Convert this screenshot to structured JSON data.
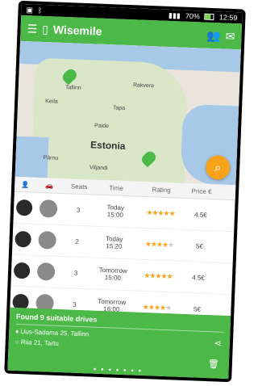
{
  "statusbar": {
    "time": "12:59",
    "battery": "70%"
  },
  "appbar": {
    "title": "Wisemile"
  },
  "map": {
    "labels": [
      "Tallinn",
      "Rakvere",
      "Keila",
      "Tapa",
      "Paide",
      "Pärnu",
      "Viljandi"
    ],
    "country": "Estonia"
  },
  "table": {
    "headers": {
      "seats": "Seats",
      "time": "Time",
      "rating": "Rating",
      "price": "Price €"
    },
    "rows": [
      {
        "seats": "3",
        "day": "Today",
        "time": "15:00",
        "stars": 5,
        "price": "4.5€"
      },
      {
        "seats": "2",
        "day": "Today",
        "time": "15:20",
        "stars": 4,
        "price": "5€"
      },
      {
        "seats": "3",
        "day": "Tomorrow",
        "time": "15:00",
        "stars": 5,
        "price": "4.5€"
      },
      {
        "seats": "3",
        "day": "Tomorrow",
        "time": "16:00",
        "stars": 4,
        "price": "5€"
      }
    ]
  },
  "footer": {
    "found": "Found 9 suitable drives",
    "from": "Uus-Sadama 25, Tallinn",
    "to": "Riia 21, Tartu"
  }
}
